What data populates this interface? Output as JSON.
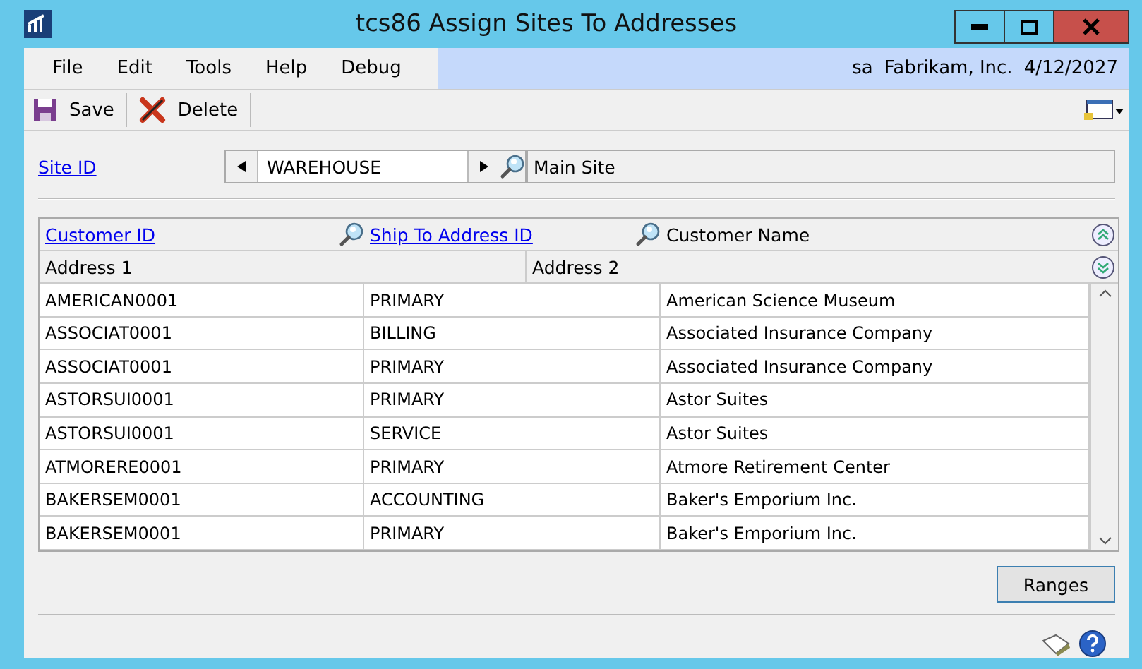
{
  "window": {
    "title": "tcs86 Assign Sites To Addresses"
  },
  "menu": [
    "File",
    "Edit",
    "Tools",
    "Help",
    "Debug"
  ],
  "user_info": {
    "user": "sa",
    "company": "Fabrikam, Inc.",
    "date": "4/12/2027"
  },
  "toolbar": [
    {
      "kind": "save",
      "label": "Save"
    },
    {
      "kind": "delete",
      "label": "Delete"
    }
  ],
  "site": {
    "label": "Site ID",
    "value": "WAREHOUSE",
    "description": "Main Site"
  },
  "grid": {
    "columns": [
      "Customer ID",
      "Ship To Address ID",
      "Customer Name"
    ],
    "subcolumns": [
      "Address 1",
      "Address 2"
    ],
    "rows": [
      {
        "customer_id": "AMERICAN0001",
        "ship_to": "PRIMARY",
        "name": "American Science Museum"
      },
      {
        "customer_id": "ASSOCIAT0001",
        "ship_to": "BILLING",
        "name": "Associated Insurance Company"
      },
      {
        "customer_id": "ASSOCIAT0001",
        "ship_to": "PRIMARY",
        "name": "Associated Insurance Company"
      },
      {
        "customer_id": "ASTORSUI0001",
        "ship_to": "PRIMARY",
        "name": "Astor Suites"
      },
      {
        "customer_id": "ASTORSUI0001",
        "ship_to": "SERVICE",
        "name": "Astor Suites"
      },
      {
        "customer_id": "ATMORERE0001",
        "ship_to": "PRIMARY",
        "name": "Atmore Retirement Center"
      },
      {
        "customer_id": "BAKERSEM0001",
        "ship_to": "ACCOUNTING",
        "name": "Baker's Emporium Inc."
      },
      {
        "customer_id": "BAKERSEM0001",
        "ship_to": "PRIMARY",
        "name": "Baker's Emporium Inc."
      }
    ]
  },
  "buttons": [
    "Ranges"
  ]
}
